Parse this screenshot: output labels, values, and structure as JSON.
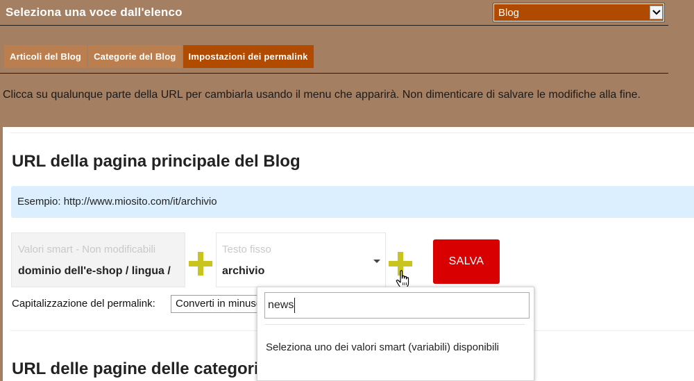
{
  "header": {
    "title": "Seleziona una voce dall'elenco",
    "select_value": "Blog"
  },
  "tabs": [
    {
      "label": "Articoli del Blog",
      "active": false
    },
    {
      "label": "Categorie del Blog",
      "active": false
    },
    {
      "label": "Impostazioni dei permalink",
      "active": true
    }
  ],
  "hint": "Clicca su qualunque parte della URL per cambiarla usando il menu che apparirà. Non dimenticare di salvare le modifiche alla fine.",
  "main_section": {
    "title": "URL della pagina principale del Blog",
    "example": "Esempio: http://www.miosito.com/it/archivio",
    "smart_box": {
      "placeholder": "Valori smart - Non modificabili",
      "value": "dominio dell'e-shop / lingua /"
    },
    "fixed_box": {
      "placeholder": "Testo fisso",
      "value": "archivio"
    },
    "save_label": "SALVA",
    "capitalization_label": "Capitalizzazione del permalink:",
    "capitalization_value": "Converti in minuscolo"
  },
  "next_section": {
    "title": "URL delle pagine delle categorie"
  },
  "dropdown": {
    "search_value": "news",
    "message": "Seleziona uno dei valori smart (variabili) disponibili"
  },
  "colors": {
    "background": "#a57f62",
    "tab": "#bb7f4f",
    "tab_active": "#b04b00",
    "save": "#d80000",
    "plus": "#c9c41e",
    "example_bg": "#dcefff"
  },
  "icons": [
    "chevron-down-icon",
    "plus-icon",
    "hand-pointer-icon"
  ]
}
